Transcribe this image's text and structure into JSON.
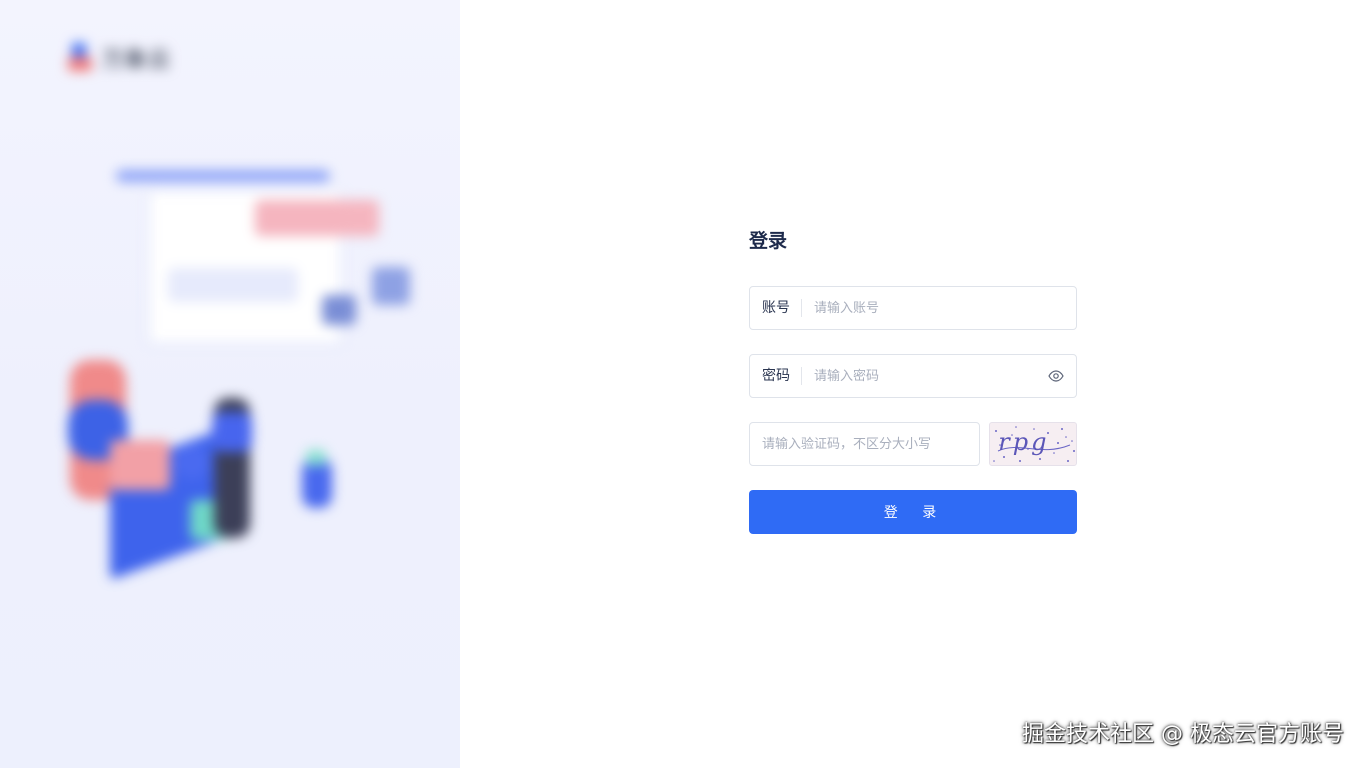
{
  "brand": {
    "logo_text": "万象云"
  },
  "login": {
    "title": "登录",
    "account": {
      "label": "账号",
      "placeholder": "请输入账号",
      "value": ""
    },
    "password": {
      "label": "密码",
      "placeholder": "请输入密码",
      "value": "",
      "toggle_icon": "eye-icon"
    },
    "captcha": {
      "placeholder": "请输入验证码，不区分大小写",
      "value": "",
      "image_text": "rpg"
    },
    "submit_label": "登 录"
  },
  "watermark": "掘金技术社区 @ 极态云官方账号",
  "colors": {
    "primary": "#2f6bf5",
    "title": "#1d2a4b",
    "border": "#dfe3ea",
    "panel_bg": "#f0f2fe"
  }
}
